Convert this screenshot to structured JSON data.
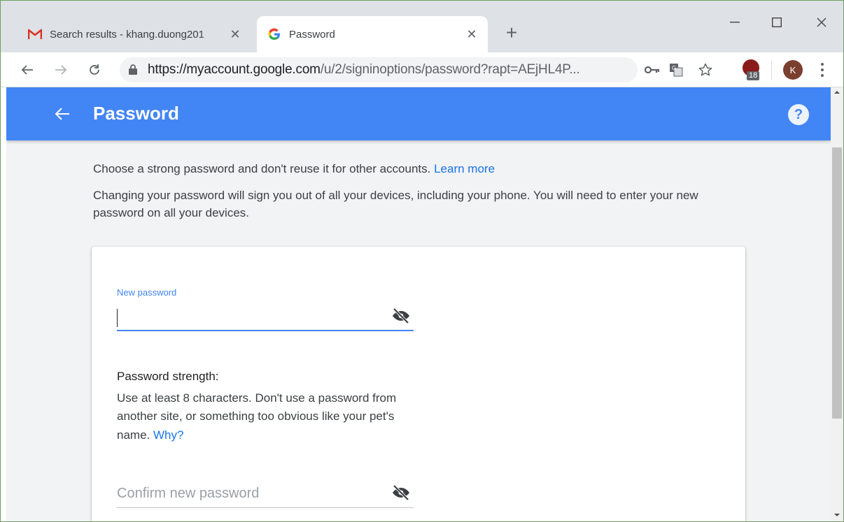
{
  "browser": {
    "tabs": [
      {
        "title": "Search results - khang.duong201",
        "icon": "gmail-icon",
        "close": "✕"
      },
      {
        "title": "Password",
        "icon": "google-icon",
        "close": "✕"
      }
    ],
    "new_tab": "+",
    "window_controls": {
      "minimize": "—",
      "maximize": "☐",
      "close": "✕"
    },
    "url_host": "https://myaccount.google.com",
    "url_rest": "/u/2/signinoptions/password?rapt=AEjHL4P...",
    "extension_badge_count": "18",
    "avatar_letter": "K"
  },
  "header": {
    "title": "Password",
    "help": "?",
    "accent_color": "#4285f4"
  },
  "intro": {
    "line1": "Choose a strong password and don't reuse it for other accounts. ",
    "learn_more": "Learn more",
    "line2": "Changing your password will sign you out of all your devices, including your phone. You will need to enter your new password on all your devices."
  },
  "form": {
    "new_password_label": "New password",
    "new_password_value": "",
    "strength_title": "Password strength:",
    "strength_text": "Use at least 8 characters. Don't use a password from another site, or something too obvious like your pet's name. ",
    "why_link": "Why?",
    "confirm_placeholder": "Confirm new password"
  }
}
